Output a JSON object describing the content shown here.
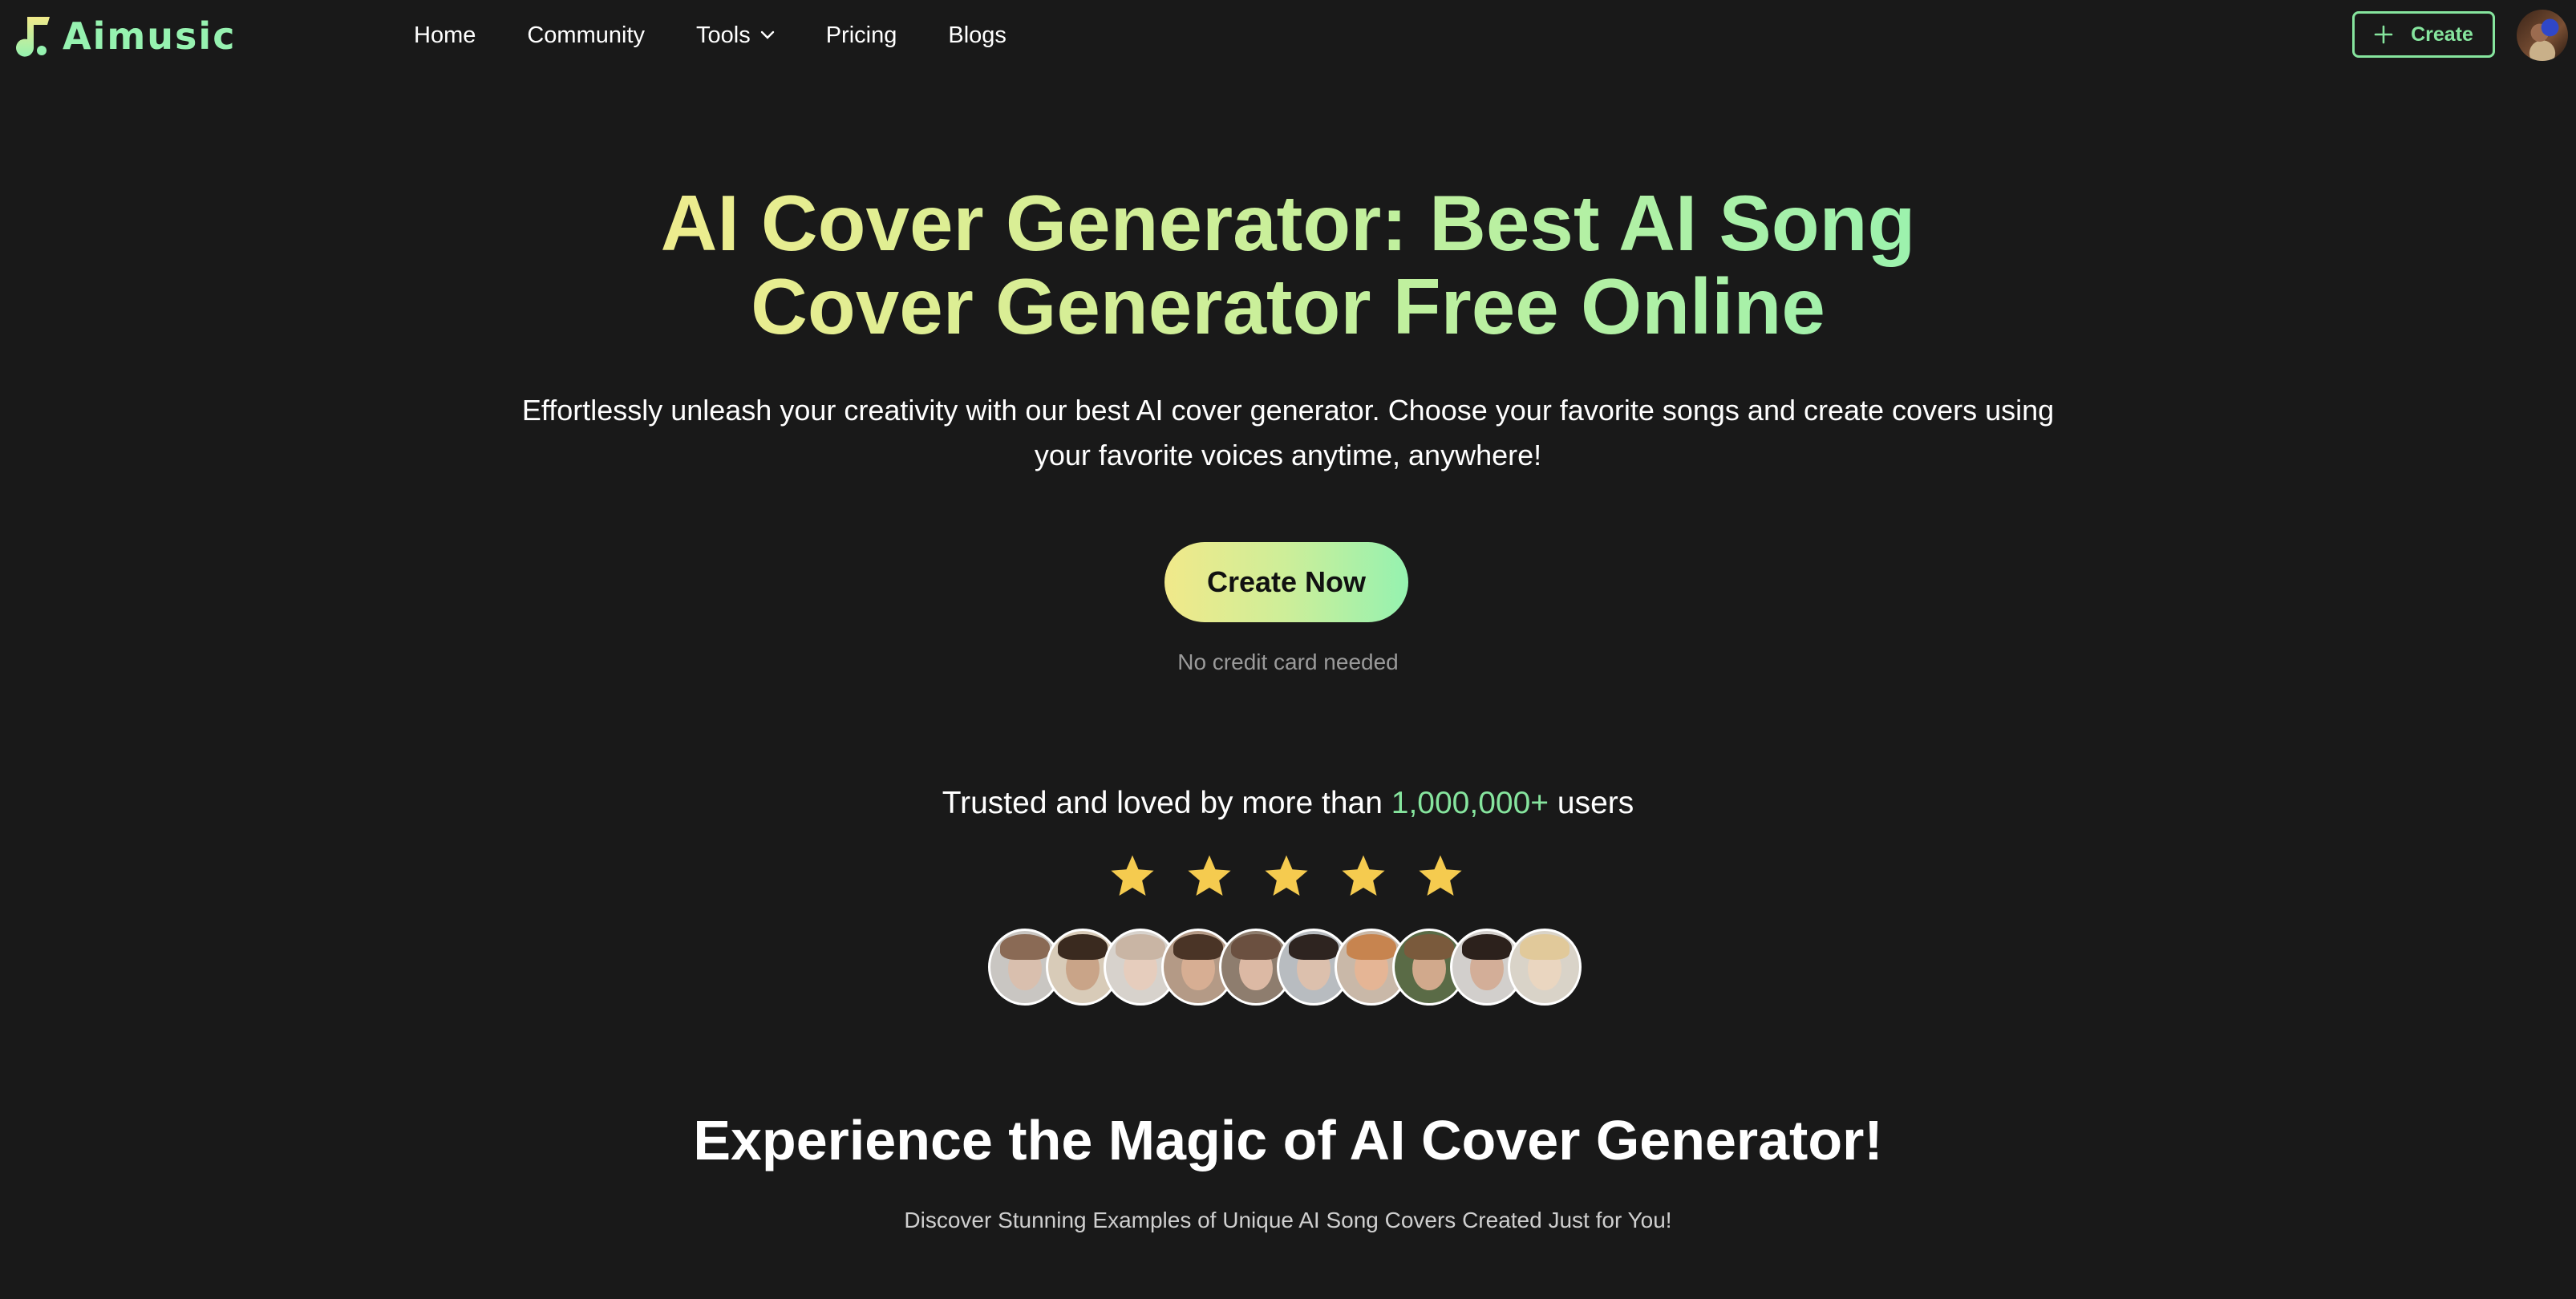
{
  "brand": {
    "name": "Aimusic",
    "logo_icon": "music-note-icon"
  },
  "nav": {
    "items": [
      {
        "label": "Home"
      },
      {
        "label": "Community"
      },
      {
        "label": "Tools",
        "icon": "chevron-down-icon"
      },
      {
        "label": "Pricing"
      },
      {
        "label": "Blogs"
      }
    ],
    "create_label": "Create",
    "create_icon": "plus-icon",
    "avatar": "user-avatar"
  },
  "hero": {
    "title": "AI Cover Generator: Best AI Song Cover Generator Free Online",
    "subtitle": "Effortlessly unleash your creativity with our best AI cover generator. Choose your favorite songs and create covers using your favorite voices anytime, anywhere!",
    "cta_label": "Create Now",
    "cta_note": "No credit card needed"
  },
  "trust": {
    "prefix": "Trusted and loved by more than ",
    "count": "1,000,000+",
    "suffix": " users",
    "rating": 5,
    "rating_max": 5,
    "user_faces": 10
  },
  "section2": {
    "title": "Experience the Magic of AI Cover Generator!",
    "subtitle": "Discover Stunning Examples of Unique AI Song Covers Created Just for You!"
  },
  "colors": {
    "background": "#191919",
    "accent_green": "#86e59e",
    "gradient_start": "#f3ec8c",
    "gradient_end": "#96f2b0",
    "star": "#f5cb4f"
  }
}
